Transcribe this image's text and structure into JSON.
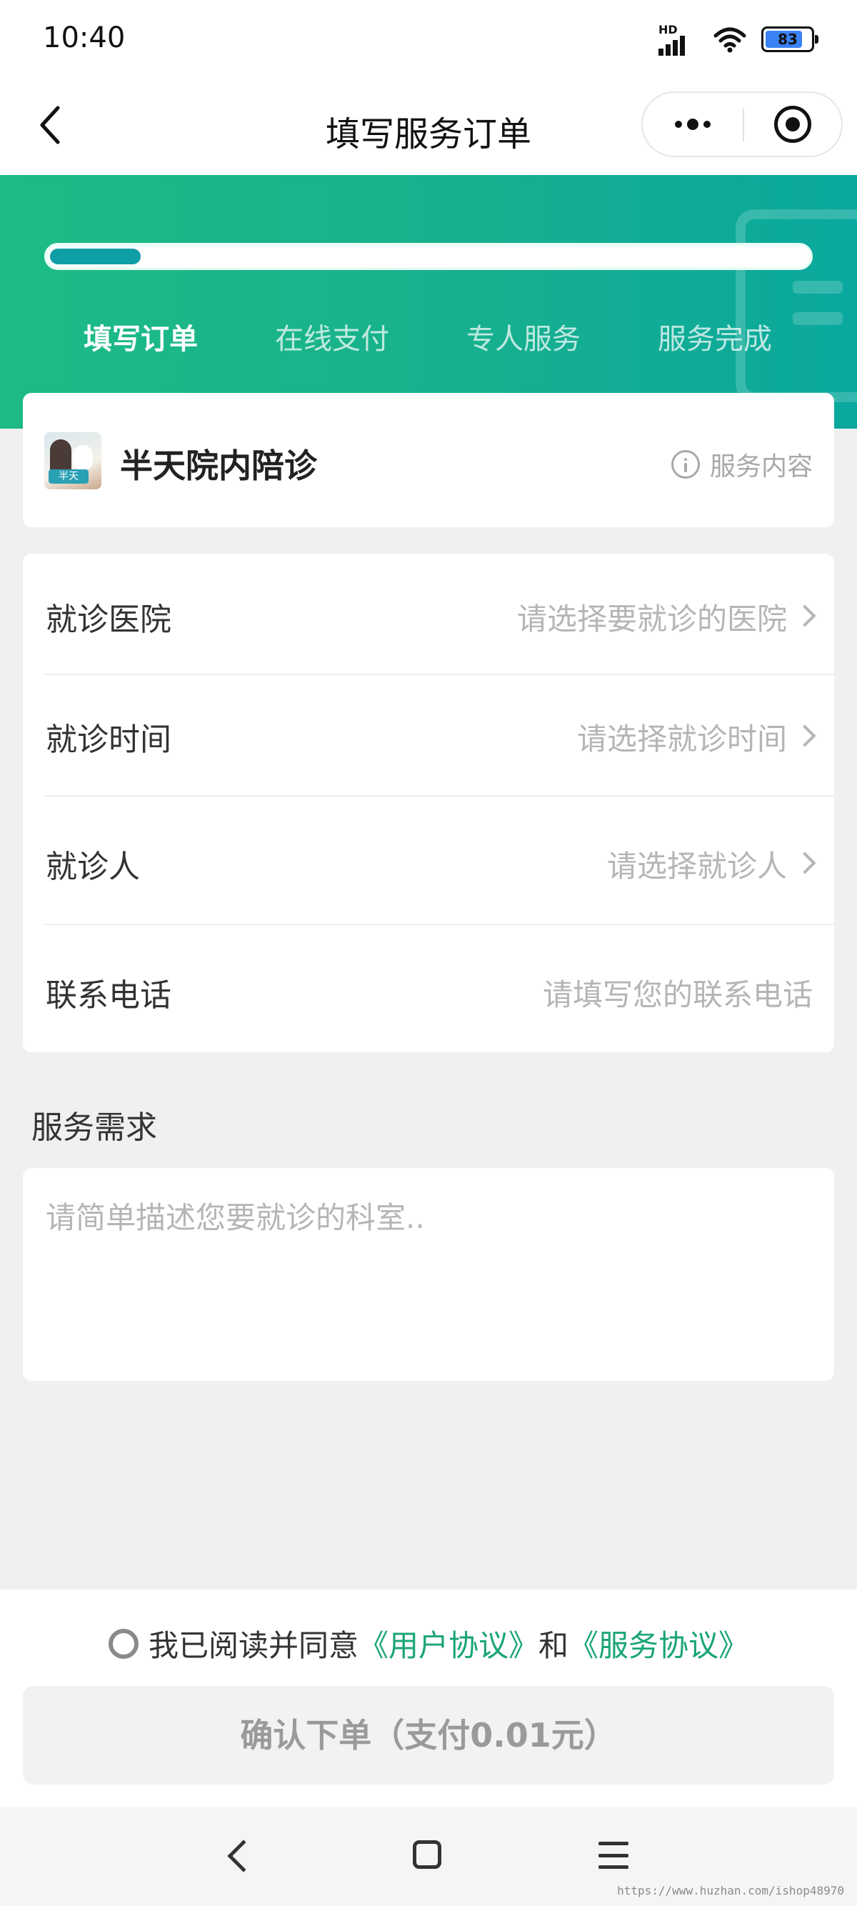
{
  "status_bar": {
    "time": "10:40",
    "network_label": "HD",
    "battery_level": "83",
    "battery_percent": 83
  },
  "nav": {
    "title": "填写服务订单",
    "icons": [
      "chevron-left-icon",
      "more-dots-icon",
      "target-icon"
    ]
  },
  "progress": {
    "fraction": 0.12,
    "steps": [
      {
        "label": "填写订单",
        "active": true
      },
      {
        "label": "在线支付",
        "active": false
      },
      {
        "label": "专人服务",
        "active": false
      },
      {
        "label": "服务完成",
        "active": false
      }
    ]
  },
  "service": {
    "thumb_label": "半天",
    "name": "半天院内陪诊",
    "content_link": "服务内容"
  },
  "form": {
    "rows": [
      {
        "label": "就诊医院",
        "placeholder": "请选择要就诊的医院",
        "has_arrow": true
      },
      {
        "label": "就诊时间",
        "placeholder": "请选择就诊时间",
        "has_arrow": true
      },
      {
        "label": "就诊人",
        "placeholder": "请选择就诊人",
        "has_arrow": true
      },
      {
        "label": "联系电话",
        "placeholder": "请填写您的联系电话",
        "has_arrow": false
      }
    ]
  },
  "demand": {
    "title": "服务需求",
    "placeholder": "请简单描述您要就诊的科室.."
  },
  "footer": {
    "agree_prefix": "我已阅读并同意",
    "user_agreement": "《用户协议》",
    "and": "和",
    "service_agreement": "《服务协议》",
    "confirm_button": "确认下单（支付0.01元）"
  },
  "watermark": "https://www.huzhan.com/ishop48970",
  "colors": {
    "brand_green": "#1dbb86",
    "brand_teal": "#0aa89e",
    "link": "#1aa478"
  }
}
